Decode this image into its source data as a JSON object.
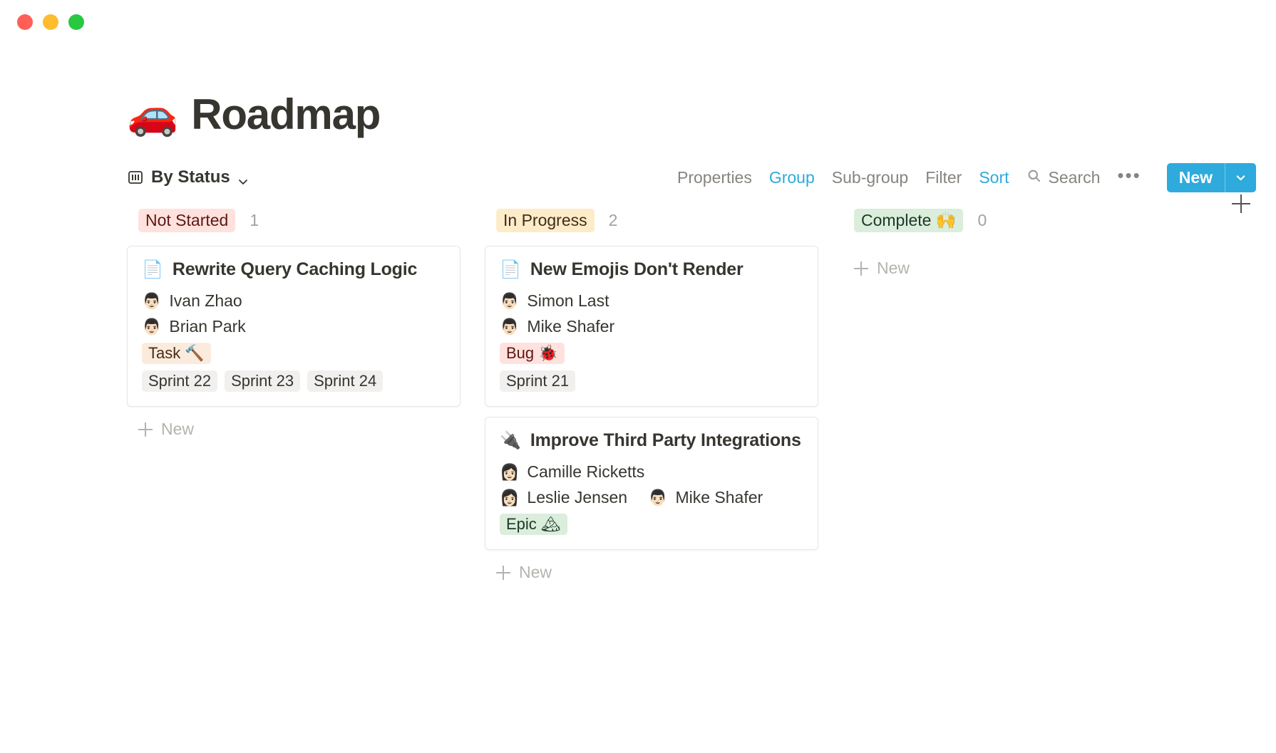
{
  "window": {
    "traffic_lights": [
      {
        "name": "close",
        "color": "#ff5f57"
      },
      {
        "name": "minimize",
        "color": "#febc2e"
      },
      {
        "name": "maximize",
        "color": "#28c840"
      }
    ]
  },
  "page": {
    "emoji": "🚗",
    "title": "Roadmap"
  },
  "toolbar": {
    "view_name": "By Status",
    "view_icon": "board-icon",
    "properties_label": "Properties",
    "group_label": "Group",
    "subgroup_label": "Sub-group",
    "filter_label": "Filter",
    "sort_label": "Sort",
    "search_label": "Search",
    "more_label": "•••",
    "new_label": "New",
    "accent_color": "#2eaadc",
    "muted_color": "#87847f"
  },
  "board": {
    "add_group_label": "+",
    "columns": [
      {
        "id": "not-started",
        "name": "Not Started",
        "count": "1",
        "badge_bg": "#ffe2dd",
        "badge_fg": "#5d1715",
        "new_label": "New",
        "cards": [
          {
            "icon": "📄",
            "title": "Rewrite Query Caching Logic",
            "people_rows": [
              [
                {
                  "avatar": "👨🏻",
                  "name": "Ivan Zhao"
                }
              ],
              [
                {
                  "avatar": "👨🏻",
                  "name": "Brian Park"
                }
              ]
            ],
            "type_tag": {
              "label": "Task 🔨",
              "style": "tag-task"
            },
            "sprints": [
              "Sprint 22",
              "Sprint 23",
              "Sprint 24"
            ]
          }
        ]
      },
      {
        "id": "in-progress",
        "name": "In Progress",
        "count": "2",
        "badge_bg": "#fdecc8",
        "badge_fg": "#402c1b",
        "new_label": "New",
        "cards": [
          {
            "icon": "📄",
            "title": "New Emojis Don't Render",
            "people_rows": [
              [
                {
                  "avatar": "👨🏻",
                  "name": "Simon Last"
                }
              ],
              [
                {
                  "avatar": "👨🏻",
                  "name": "Mike Shafer"
                }
              ]
            ],
            "type_tag": {
              "label": "Bug 🐞",
              "style": "tag-bug"
            },
            "sprints": [
              "Sprint 21"
            ]
          },
          {
            "icon": "🔌",
            "title": "Improve Third Party Integrations",
            "people_rows": [
              [
                {
                  "avatar": "👩🏻",
                  "name": "Camille Ricketts"
                }
              ],
              [
                {
                  "avatar": "👩🏻",
                  "name": "Leslie Jensen"
                },
                {
                  "avatar": "👨🏻",
                  "name": "Mike Shafer"
                }
              ]
            ],
            "type_tag": {
              "label": "Epic 🏔",
              "style": "tag-epic"
            },
            "sprints": []
          }
        ]
      },
      {
        "id": "complete",
        "name": "Complete 🙌",
        "count": "0",
        "badge_bg": "#dbeddb",
        "badge_fg": "#1c3829",
        "new_label": "New",
        "cards": []
      }
    ]
  }
}
